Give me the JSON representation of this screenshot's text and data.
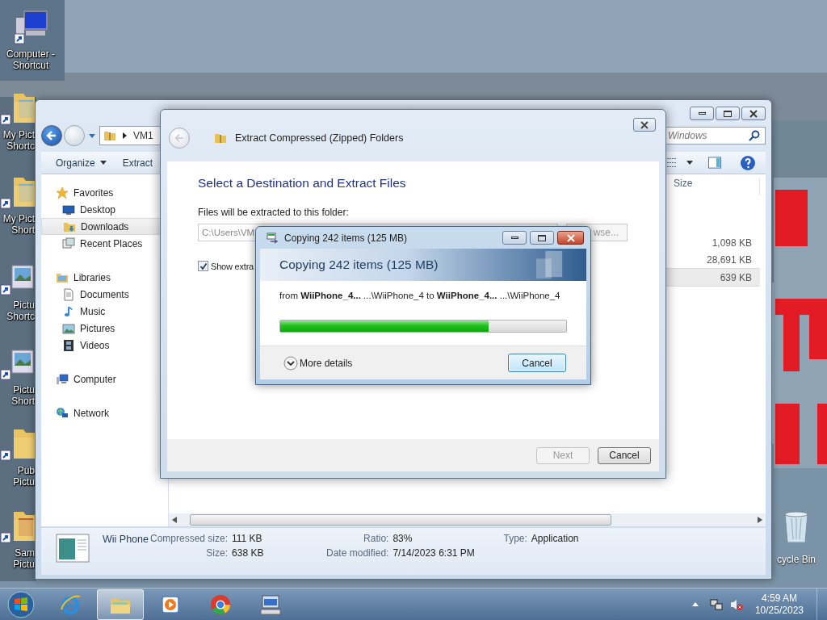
{
  "desktop": {
    "icons": [
      {
        "kind": "computer",
        "lines": [
          "Computer -",
          "Shortcut"
        ]
      },
      {
        "kind": "picture-folder",
        "lines": [
          "My Pict",
          "Shortc"
        ]
      },
      {
        "kind": "picture-folder",
        "lines": [
          "My Pict",
          "Short"
        ]
      },
      {
        "kind": "picture",
        "lines": [
          "Pictu",
          "Shortc"
        ]
      },
      {
        "kind": "picture",
        "lines": [
          "Pictu",
          "Short"
        ]
      },
      {
        "kind": "folder",
        "lines": [
          "Pub",
          "Pictu"
        ]
      },
      {
        "kind": "photo-folder",
        "lines": [
          "Sam",
          "Pictu"
        ]
      }
    ],
    "recycle_bin": {
      "label": "cycle Bin"
    }
  },
  "explorer": {
    "address": [
      "VM1"
    ],
    "search": {
      "placeholder": "Windows"
    },
    "toolbar": [
      "Organize",
      "Extract"
    ],
    "nav": [
      {
        "label": "Favorites",
        "kind": "star",
        "selected": false,
        "children": [
          {
            "label": "Desktop",
            "kind": "desktop",
            "selected": false
          },
          {
            "label": "Downloads",
            "kind": "downloads",
            "selected": true
          },
          {
            "label": "Recent Places",
            "kind": "recent",
            "selected": false
          }
        ]
      },
      {
        "label": "Libraries",
        "kind": "library",
        "selected": false,
        "children": [
          {
            "label": "Documents",
            "kind": "document",
            "selected": false
          },
          {
            "label": "Music",
            "kind": "music",
            "selected": false
          },
          {
            "label": "Pictures",
            "kind": "picture",
            "selected": false
          },
          {
            "label": "Videos",
            "kind": "video",
            "selected": false
          }
        ]
      },
      {
        "label": "Computer",
        "kind": "computer",
        "selected": false
      },
      {
        "label": "Network",
        "kind": "network",
        "selected": false
      }
    ],
    "size_header": "Size",
    "files": [
      {
        "size": "1,098 KB",
        "selected": false
      },
      {
        "size": "28,691 KB",
        "selected": false
      },
      {
        "size": "639 KB",
        "selected": true
      }
    ],
    "details": {
      "name": "Wii Phone",
      "fields": [
        {
          "label": "Compressed size:",
          "value": "111 KB"
        },
        {
          "label": "Size:",
          "value": "638 KB"
        },
        {
          "label": "Ratio:",
          "value": "83%"
        },
        {
          "label": "Date modified:",
          "value": "7/14/2023 6:31 PM"
        },
        {
          "label": "Type:",
          "value": "Application"
        }
      ]
    }
  },
  "extract_dialog": {
    "title": "Extract Compressed (Zipped) Folders",
    "heading": "Select a Destination and Extract Files",
    "folder_label": "Files will be extracted to this folder:",
    "folder_value": "C:\\Users\\VM",
    "browse": "wse...",
    "show_checkbox": {
      "label": "Show extra",
      "checked": true
    },
    "buttons": [
      {
        "label": "Next",
        "disabled": true
      },
      {
        "label": "Cancel",
        "disabled": false
      }
    ]
  },
  "copy_dialog": {
    "title": "Copying 242 items (125 MB)",
    "heading": "Copying 242 items (125 MB)",
    "from_line": "from **WiiPhone_4...** ...\\WiiPhone_4 to **WiiPhone_4...** ...\\WiiPhone_4",
    "progress": {
      "level": 0.73
    },
    "more": "More details",
    "cancel": "Cancel"
  },
  "taskbar": {
    "apps": [
      {
        "kind": "ie",
        "active": false
      },
      {
        "kind": "explorer",
        "active": true
      },
      {
        "kind": "media",
        "active": false
      },
      {
        "kind": "chrome",
        "active": false
      },
      {
        "kind": "keyboard",
        "active": false
      }
    ],
    "time": "4:59 AM",
    "date": "10/25/2023"
  }
}
